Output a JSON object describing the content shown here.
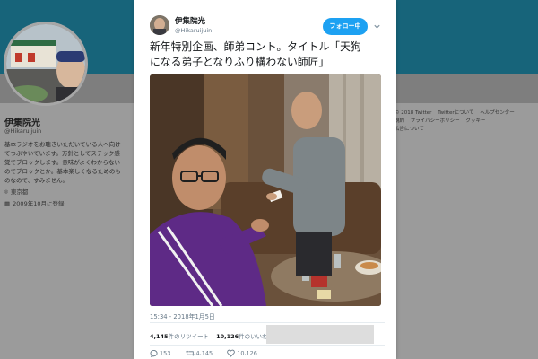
{
  "background": {
    "profile_name": "伊集院光",
    "profile_handle": "@Hikaruijuin",
    "bio_lines": [
      "基本ラジオをお聴きいただいている人へ向け",
      "てつぶやいています。方針としてステック感",
      "覚でブロックします。意味がよくわからない",
      "のでブロックとか。基本楽しくなるためのも",
      "のなので、すみません。"
    ],
    "location": "東京都",
    "joined": "2009年10月に登録",
    "footer_lines": [
      [
        "© 2018 Twitter",
        "Twitterについて",
        "ヘルプセンター"
      ],
      [
        "規約",
        "プライバシーポリシー",
        "クッキー"
      ],
      [
        "広告について"
      ]
    ]
  },
  "tweet": {
    "author_name": "伊集院光",
    "author_handle": "@Hikaruijuin",
    "follow_label": "フォロー中",
    "text_line1": "新年特別企画、師弟コント。タイトル「天狗",
    "text_line2": "になる弟子となりふり構わない師匠」",
    "timestamp": "15:34 - 2018年1月5日",
    "retweet_count": "4,145",
    "retweet_label": "件のリツイート",
    "like_count": "10,126",
    "like_label": "件のいいね",
    "actions": {
      "reply": "153",
      "retweet": "4,145",
      "like": "10,126"
    }
  },
  "colors": {
    "accent": "#1da1f2",
    "banner": "#17647a",
    "text": "#14171a",
    "muted": "#657786"
  }
}
